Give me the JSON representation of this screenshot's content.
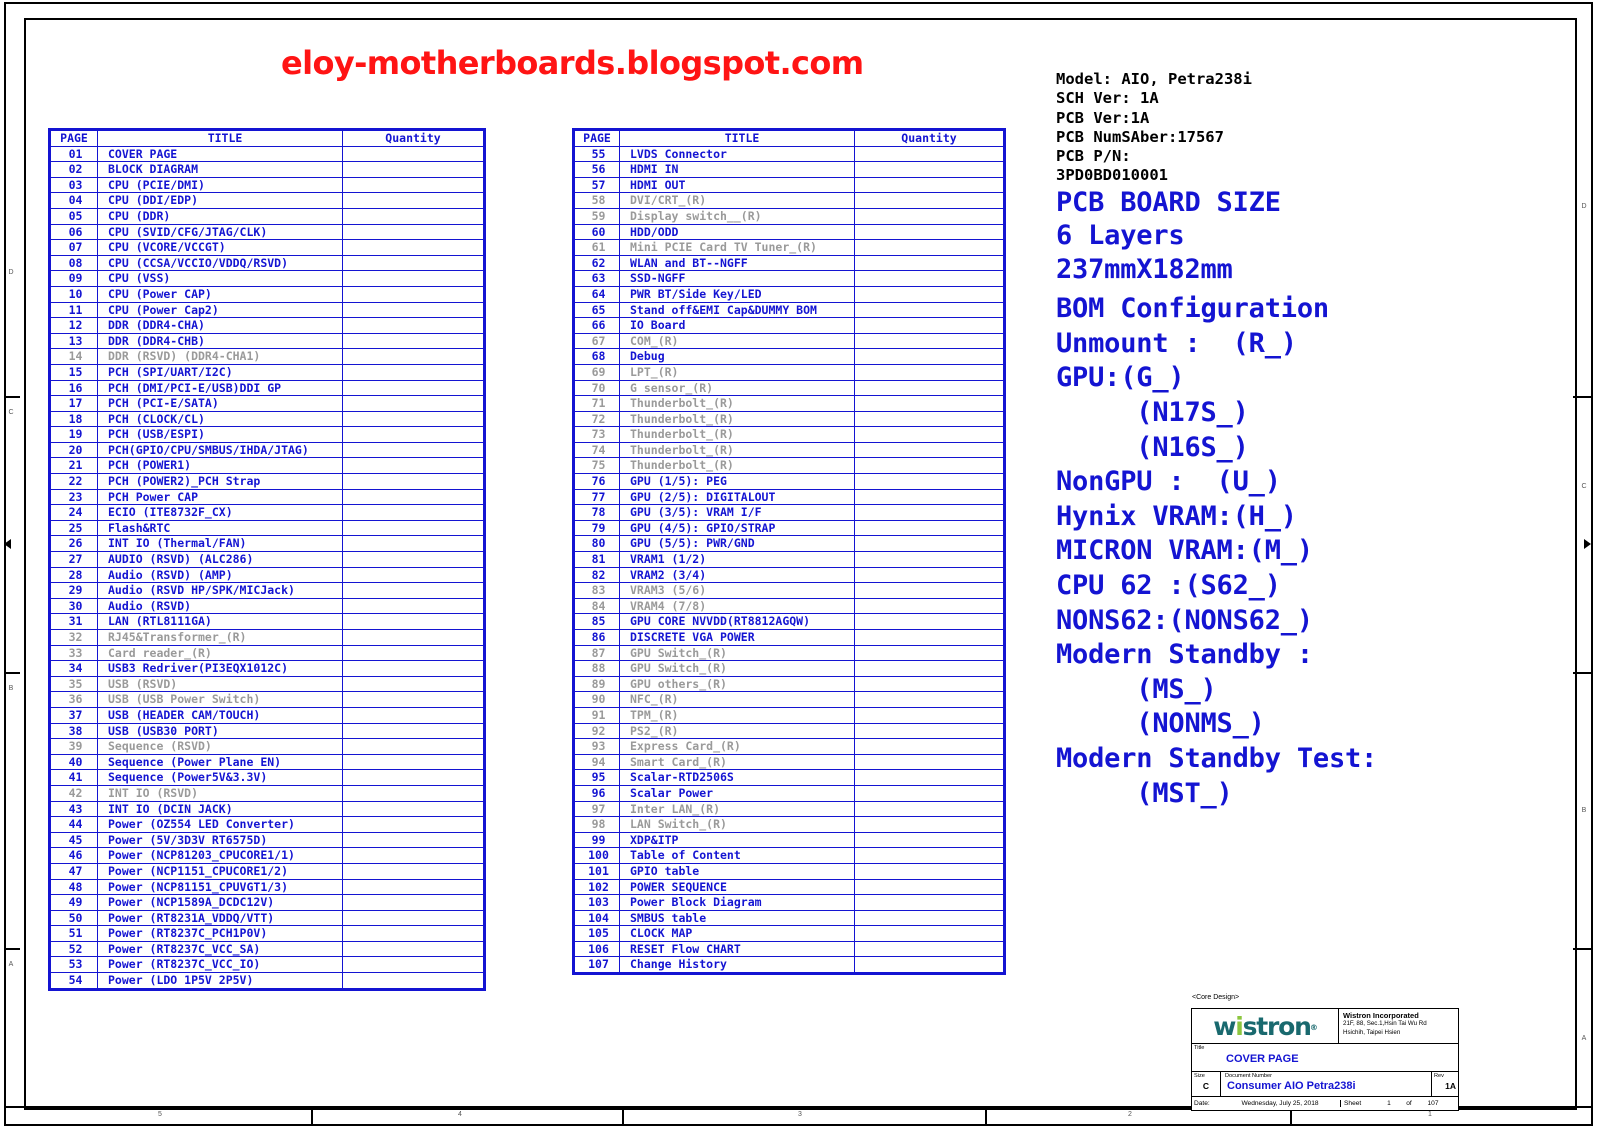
{
  "blog_watermark": "eloy-motherboards.blogspot.com",
  "sheet_zones": {
    "rows": [
      "D",
      "C",
      "B",
      "A"
    ],
    "columns": [
      "5",
      "4",
      "3",
      "2",
      "1"
    ]
  },
  "toc_headers": {
    "page": "PAGE",
    "title": "TITLE",
    "quantity": "Quantity"
  },
  "toc_left": [
    {
      "page": "01",
      "title": "COVER PAGE",
      "dim": false
    },
    {
      "page": "02",
      "title": "BLOCK DIAGRAM",
      "dim": false
    },
    {
      "page": "03",
      "title": "CPU  (PCIE/DMI)",
      "dim": false
    },
    {
      "page": "04",
      "title": "CPU  (DDI/EDP)",
      "dim": false
    },
    {
      "page": "05",
      "title": "CPU  (DDR)",
      "dim": false
    },
    {
      "page": "06",
      "title": "CPU  (SVID/CFG/JTAG/CLK)",
      "dim": false
    },
    {
      "page": "07",
      "title": "CPU  (VCORE/VCCGT)",
      "dim": false
    },
    {
      "page": "08",
      "title": "CPU  (CCSA/VCCIO/VDDQ/RSVD)",
      "dim": false
    },
    {
      "page": "09",
      "title": "CPU  (VSS)",
      "dim": false
    },
    {
      "page": "10",
      "title": "CPU  (Power CAP)",
      "dim": false
    },
    {
      "page": "11",
      "title": "CPU  (Power Cap2)",
      "dim": false
    },
    {
      "page": "12",
      "title": "DDR  (DDR4-CHA)",
      "dim": false
    },
    {
      "page": "13",
      "title": "DDR  (DDR4-CHB)",
      "dim": false
    },
    {
      "page": "14",
      "title": "DDR  (RSVD)  (DDR4-CHA1)",
      "dim": true
    },
    {
      "page": "15",
      "title": "PCH  (SPI/UART/I2C)",
      "dim": false
    },
    {
      "page": "16",
      "title": "PCH  (DMI/PCI-E/USB)DDI GP",
      "dim": false
    },
    {
      "page": "17",
      "title": "PCH  (PCI-E/SATA)",
      "dim": false
    },
    {
      "page": "18",
      "title": "PCH  (CLOCK/CL)",
      "dim": false
    },
    {
      "page": "19",
      "title": "PCH  (USB/ESPI)",
      "dim": false
    },
    {
      "page": "20",
      "title": "PCH(GPIO/CPU/SMBUS/IHDA/JTAG)",
      "dim": false
    },
    {
      "page": "21",
      "title": "PCH  (POWER1)",
      "dim": false
    },
    {
      "page": "22",
      "title": "PCH  (POWER2)_PCH Strap",
      "dim": false
    },
    {
      "page": "23",
      "title": "PCH Power CAP",
      "dim": false
    },
    {
      "page": "24",
      "title": "ECIO (ITE8732F_CX)",
      "dim": false
    },
    {
      "page": "25",
      "title": "Flash&RTC",
      "dim": false
    },
    {
      "page": "26",
      "title": "INT IO (Thermal/FAN)",
      "dim": false
    },
    {
      "page": "27",
      "title": "AUDIO (RSVD) (ALC286)",
      "dim": false
    },
    {
      "page": "28",
      "title": "Audio (RSVD) (AMP)",
      "dim": false
    },
    {
      "page": "29",
      "title": "Audio (RSVD HP/SPK/MICJack)",
      "dim": false
    },
    {
      "page": "30",
      "title": "Audio (RSVD)",
      "dim": false
    },
    {
      "page": "31",
      "title": "LAN (RTL8111GA)",
      "dim": false
    },
    {
      "page": "32",
      "title": "RJ45&Transformer_(R)",
      "dim": true
    },
    {
      "page": "33",
      "title": "Card reader_(R)",
      "dim": true
    },
    {
      "page": "34",
      "title": "USB3 Redriver(PI3EQX1012C)",
      "dim": false
    },
    {
      "page": "35",
      "title": "USB (RSVD)",
      "dim": true
    },
    {
      "page": "36",
      "title": "USB (USB Power Switch)",
      "dim": true
    },
    {
      "page": "37",
      "title": "USB (HEADER CAM/TOUCH)",
      "dim": false
    },
    {
      "page": "38",
      "title": "USB (USB30 PORT)",
      "dim": false
    },
    {
      "page": "39",
      "title": "Sequence (RSVD)",
      "dim": true
    },
    {
      "page": "40",
      "title": "Sequence (Power Plane EN)",
      "dim": false
    },
    {
      "page": "41",
      "title": "Sequence (Power5V&3.3V)",
      "dim": false
    },
    {
      "page": "42",
      "title": "INT IO (RSVD)",
      "dim": true
    },
    {
      "page": "43",
      "title": "INT IO (DCIN JACK)",
      "dim": false
    },
    {
      "page": "44",
      "title": "Power (OZ554 LED Converter)",
      "dim": false
    },
    {
      "page": "45",
      "title": "Power (5V/3D3V RT6575D)",
      "dim": false
    },
    {
      "page": "46",
      "title": "Power (NCP81203_CPUCORE1/1)",
      "dim": false
    },
    {
      "page": "47",
      "title": "Power (NCP1151_CPUCORE1/2)",
      "dim": false
    },
    {
      "page": "48",
      "title": "Power (NCP81151_CPUVGT1/3)",
      "dim": false
    },
    {
      "page": "49",
      "title": "Power (NCP1589A_DCDC12V)",
      "dim": false
    },
    {
      "page": "50",
      "title": "Power (RT8231A_VDDQ/VTT)",
      "dim": false
    },
    {
      "page": "51",
      "title": "Power (RT8237C_PCH1P0V)",
      "dim": false
    },
    {
      "page": "52",
      "title": "Power (RT8237C_VCC_SA)",
      "dim": false
    },
    {
      "page": "53",
      "title": "Power (RT8237C_VCC_IO)",
      "dim": false
    },
    {
      "page": "54",
      "title": "Power (LDO 1P5V 2P5V)",
      "dim": false
    }
  ],
  "toc_right": [
    {
      "page": "55",
      "title": "LVDS Connector",
      "dim": false
    },
    {
      "page": "56",
      "title": "HDMI IN",
      "dim": false
    },
    {
      "page": "57",
      "title": "HDMI OUT",
      "dim": false
    },
    {
      "page": "58",
      "title": "DVI/CRT_(R)",
      "dim": true
    },
    {
      "page": "59",
      "title": "Display switch__(R)",
      "dim": true
    },
    {
      "page": "60",
      "title": "HDD/ODD",
      "dim": false
    },
    {
      "page": "61",
      "title": "Mini PCIE Card TV Tuner_(R)",
      "dim": true
    },
    {
      "page": "62",
      "title": "WLAN and BT--NGFF",
      "dim": false
    },
    {
      "page": "63",
      "title": "SSD-NGFF",
      "dim": false
    },
    {
      "page": "64",
      "title": "PWR BT/Side Key/LED",
      "dim": false
    },
    {
      "page": "65",
      "title": "Stand off&EMI Cap&DUMMY BOM",
      "dim": false
    },
    {
      "page": "66",
      "title": "IO Board",
      "dim": false
    },
    {
      "page": "67",
      "title": "COM_(R)",
      "dim": true
    },
    {
      "page": "68",
      "title": "Debug",
      "dim": false
    },
    {
      "page": "69",
      "title": "LPT_(R)",
      "dim": true
    },
    {
      "page": "70",
      "title": "G sensor_(R)",
      "dim": true
    },
    {
      "page": "71",
      "title": "Thunderbolt_(R)",
      "dim": true
    },
    {
      "page": "72",
      "title": "Thunderbolt_(R)",
      "dim": true
    },
    {
      "page": "73",
      "title": "Thunderbolt_(R)",
      "dim": true
    },
    {
      "page": "74",
      "title": "Thunderbolt_(R)",
      "dim": true
    },
    {
      "page": "75",
      "title": "Thunderbolt_(R)",
      "dim": true
    },
    {
      "page": "76",
      "title": "GPU (1/5): PEG",
      "dim": false
    },
    {
      "page": "77",
      "title": "GPU (2/5): DIGITALOUT",
      "dim": false
    },
    {
      "page": "78",
      "title": "GPU (3/5): VRAM I/F",
      "dim": false
    },
    {
      "page": "79",
      "title": "GPU (4/5): GPIO/STRAP",
      "dim": false
    },
    {
      "page": "80",
      "title": "GPU (5/5): PWR/GND",
      "dim": false
    },
    {
      "page": "81",
      "title": "VRAM1 (1/2)",
      "dim": false
    },
    {
      "page": "82",
      "title": "VRAM2 (3/4)",
      "dim": false
    },
    {
      "page": "83",
      "title": "VRAM3 (5/6)",
      "dim": true
    },
    {
      "page": "84",
      "title": "VRAM4 (7/8)",
      "dim": true
    },
    {
      "page": "85",
      "title": "GPU CORE NVVDD(RT8812AGQW)",
      "dim": false
    },
    {
      "page": "86",
      "title": "DISCRETE VGA POWER",
      "dim": false
    },
    {
      "page": "87",
      "title": "GPU Switch_(R)",
      "dim": true
    },
    {
      "page": "88",
      "title": "GPU Switch_(R)",
      "dim": true
    },
    {
      "page": "89",
      "title": "GPU others_(R)",
      "dim": true
    },
    {
      "page": "90",
      "title": "NFC_(R)",
      "dim": true
    },
    {
      "page": "91",
      "title": "TPM_(R)",
      "dim": true
    },
    {
      "page": "92",
      "title": "PS2_(R)",
      "dim": true
    },
    {
      "page": "93",
      "title": "Express Card_(R)",
      "dim": true
    },
    {
      "page": "94",
      "title": "Smart Card_(R)",
      "dim": true
    },
    {
      "page": "95",
      "title": "Scalar-RTD2506S",
      "dim": false
    },
    {
      "page": "96",
      "title": "Scalar Power",
      "dim": false
    },
    {
      "page": "97",
      "title": "Inter LAN_(R)",
      "dim": true
    },
    {
      "page": "98",
      "title": "LAN Switch_(R)",
      "dim": true
    },
    {
      "page": "99",
      "title": "XDP&ITP",
      "dim": false
    },
    {
      "page": "100",
      "title": "Table of Content",
      "dim": false
    },
    {
      "page": "101",
      "title": "GPIO table",
      "dim": false
    },
    {
      "page": "102",
      "title": "POWER SEQUENCE",
      "dim": false
    },
    {
      "page": "103",
      "title": "Power Block Diagram",
      "dim": false
    },
    {
      "page": "104",
      "title": "SMBUS table",
      "dim": false
    },
    {
      "page": "105",
      "title": "CLOCK MAP",
      "dim": false
    },
    {
      "page": "106",
      "title": "RESET Flow CHART",
      "dim": false
    },
    {
      "page": "107",
      "title": "Change History",
      "dim": false
    }
  ],
  "info_panel": {
    "model": "Model: AIO, Petra238i",
    "sch_ver": "SCH Ver: 1A",
    "pcb_ver": "PCB Ver:1A",
    "pcb_numsaber": "PCB NumSAber:17567",
    "pcb_pn_label": "PCB P/N:",
    "pcb_pn_value": "3PD0BD010001",
    "board_size_label": "PCB BOARD SIZE",
    "layers": "6 Layers",
    "dimensions": "237mmX182mm"
  },
  "bom_config": {
    "heading": "BOM Configuration",
    "unmount": "Unmount :  (R_)",
    "gpu": "GPU:(G_)",
    "gpu_n17s": "     (N17S_)",
    "gpu_n16s": "     (N16S_)",
    "nongpu": "NonGPU :  (U_)",
    "hynix_vram": "Hynix VRAM:(H_)",
    "micron_vram": "MICRON VRAM:(M_)",
    "cpu62": "CPU 62 :(S62_)",
    "nons62": "NONS62:(NONS62_)",
    "modern_standby": "Modern Standby :",
    "ms": "     (MS_)",
    "nonms": "     (NONMS_)",
    "modern_standby_test": "Modern Standby Test:",
    "mst": "     (MST_)"
  },
  "title_block": {
    "core_design": "<Core Design>",
    "logo_part1": "w",
    "logo_part2": "i",
    "logo_part3": "stron",
    "logo_registered": "®",
    "company_name": "Wistron Incorporated",
    "company_addr_line1": "21F, 88, Sec.1,Hsin Tai Wu Rd",
    "company_addr_line2": "Hsichih, Taipei Hsien",
    "title_caption": "Title",
    "title_value": "COVER PAGE",
    "size_caption": "Size",
    "size_value": "C",
    "docnum_caption": "Document Number",
    "docnum_value": "Consumer AIO Petra238i",
    "rev_caption": "Rev",
    "rev_value": "1A",
    "date_caption": "Date:",
    "date_value": "Wednesday, July 25, 2018",
    "sheet_caption": "Sheet",
    "sheet_number": "1",
    "sheet_of": "of",
    "sheet_total": "107"
  },
  "colors": {
    "schematic_blue": "#1414d2",
    "dim_gray": "#9a9a9a",
    "watermark_red": "#ff1414",
    "logo_teal": "#19696e",
    "logo_green": "#8cc63e"
  }
}
